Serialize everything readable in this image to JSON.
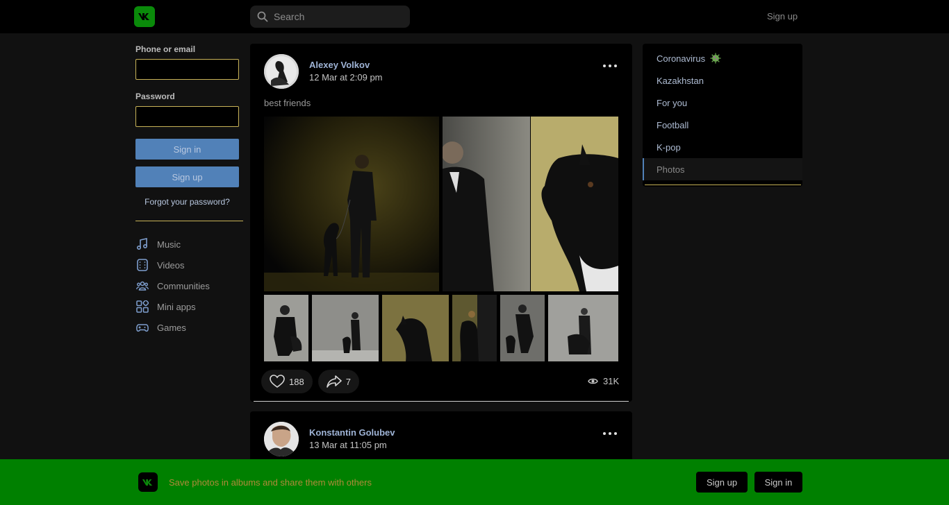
{
  "header": {
    "search_placeholder": "Search",
    "signup_label": "Sign up"
  },
  "login": {
    "phone_label": "Phone or email",
    "password_label": "Password",
    "sign_in_label": "Sign in",
    "sign_up_label": "Sign up",
    "forgot_label": "Forgot your password?"
  },
  "nav": [
    {
      "label": "Music",
      "icon": "music-icon"
    },
    {
      "label": "Videos",
      "icon": "video-icon"
    },
    {
      "label": "Communities",
      "icon": "communities-icon"
    },
    {
      "label": "Mini apps",
      "icon": "apps-icon"
    },
    {
      "label": "Games",
      "icon": "gamepad-icon"
    }
  ],
  "posts": [
    {
      "author": "Alexey Volkov",
      "date": "12 Mar at 2:09 pm",
      "text": "best friends",
      "likes": "188",
      "shares": "7",
      "views": "31K"
    },
    {
      "author": "Konstantin Golubev",
      "date": "13 Mar at 11:05 pm"
    }
  ],
  "topics": [
    {
      "label": "Coronavirus",
      "icon": "virus-icon"
    },
    {
      "label": "Kazakhstan"
    },
    {
      "label": "For you"
    },
    {
      "label": "Football"
    },
    {
      "label": "K-pop"
    },
    {
      "label": "Photos",
      "active": true
    }
  ],
  "banner": {
    "text": "Save photos in albums and share them with others",
    "sign_up_label": "Sign up",
    "sign_in_label": "Sign in"
  },
  "colors": {
    "brand_green": "#008000",
    "accent_blue": "#5181b8",
    "accent_yellow": "#c9b458"
  }
}
